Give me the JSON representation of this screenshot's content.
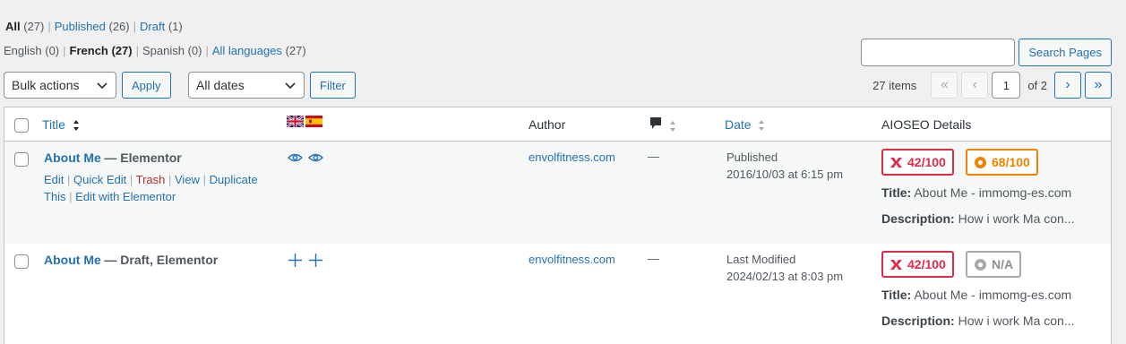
{
  "views": [
    {
      "label": "All",
      "count": "(27)",
      "current": true
    },
    {
      "label": "Published",
      "count": "(26)",
      "current": false
    },
    {
      "label": "Draft",
      "count": "(1)",
      "current": false
    }
  ],
  "languages": [
    {
      "label": "English (0)",
      "current": false,
      "link": false
    },
    {
      "label": "French (27)",
      "current": true,
      "link": false
    },
    {
      "label": "Spanish (0)",
      "current": false,
      "link": false
    },
    {
      "label": "All languages",
      "count": "(27)",
      "link": true
    }
  ],
  "search": {
    "placeholder": "",
    "button": "Search Pages"
  },
  "bulk": {
    "selected": "Bulk actions",
    "apply": "Apply"
  },
  "dates": {
    "selected": "All dates",
    "filter": "Filter"
  },
  "pagination": {
    "items": "27 items",
    "first": "«",
    "prev": "‹",
    "current": "1",
    "of": "of 2",
    "next": "›",
    "last": "»"
  },
  "columns": {
    "title": "Title",
    "author": "Author",
    "date": "Date",
    "aioseo": "AIOSEO Details"
  },
  "colors": {
    "red": "#df2a4a",
    "orange": "#f18200",
    "link": "#2271b1",
    "trash": "#b32d2e"
  },
  "rows": [
    {
      "title": "About Me",
      "state": "— Elementor",
      "actions": {
        "edit": "Edit",
        "quick_edit": "Quick Edit",
        "trash": "Trash",
        "view": "View",
        "duplicate": "Duplicate This",
        "elementor": "Edit with Elementor"
      },
      "lang_icons": [
        "eye-icon",
        "eye-icon"
      ],
      "author": "envolfitness.com",
      "comments": "—",
      "date_status": "Published",
      "date_value": "2016/10/03 at 6:15 pm",
      "seo_score": "42/100",
      "truseo_score": "68/100",
      "seo_title_label": "Title:",
      "seo_title": "About Me - immomg-es.com",
      "seo_desc_label": "Description:",
      "seo_desc": "How i work Ma con..."
    },
    {
      "title": "About Me",
      "state": "— Draft, Elementor",
      "lang_icons": [
        "plus-icon",
        "plus-icon"
      ],
      "author": "envolfitness.com",
      "comments": "—",
      "date_status": "Last Modified",
      "date_value": "2024/02/13 at 8:03 pm",
      "seo_score": "42/100",
      "truseo_score": "N/A",
      "seo_title_label": "Title:",
      "seo_title": "About Me - immomg-es.com",
      "seo_desc_label": "Description:",
      "seo_desc": "How i work Ma con..."
    }
  ]
}
